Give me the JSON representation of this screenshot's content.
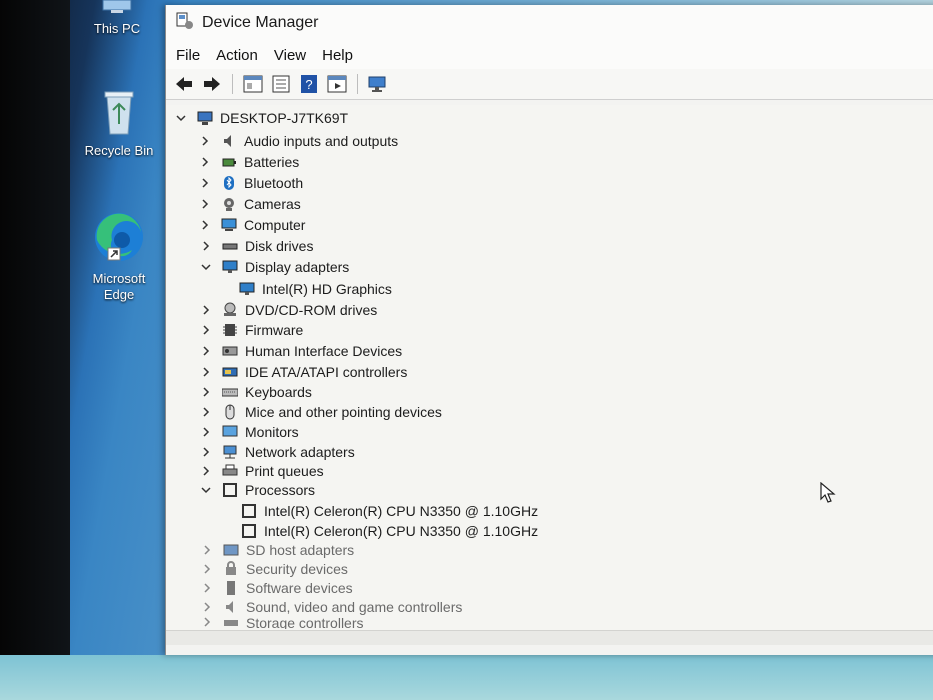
{
  "desktop": {
    "icons": [
      {
        "label": "This PC",
        "icon": "this-pc-icon"
      },
      {
        "label": "Recycle Bin",
        "icon": "recycle-bin-icon"
      },
      {
        "label_line1": "Microsoft",
        "label_line2": "Edge",
        "icon": "edge-icon"
      }
    ]
  },
  "window": {
    "title": "Device Manager",
    "menu": [
      "File",
      "Action",
      "View",
      "Help"
    ],
    "toolbar": [
      "back-icon",
      "forward-icon",
      "properties-icon",
      "show-hidden-icon",
      "help-icon",
      "run-icon",
      "scan-hardware-icon"
    ]
  },
  "tree": {
    "root": "DESKTOP-J7TK69T",
    "items": [
      {
        "label": "Audio inputs and outputs",
        "icon": "speaker-icon",
        "expanded": false
      },
      {
        "label": "Batteries",
        "icon": "battery-icon",
        "expanded": false
      },
      {
        "label": "Bluetooth",
        "icon": "bluetooth-icon",
        "expanded": false
      },
      {
        "label": "Cameras",
        "icon": "camera-icon",
        "expanded": false
      },
      {
        "label": "Computer",
        "icon": "computer-icon",
        "expanded": false
      },
      {
        "label": "Disk drives",
        "icon": "disk-drive-icon",
        "expanded": false
      },
      {
        "label": "Display adapters",
        "icon": "display-adapter-icon",
        "expanded": true,
        "children": [
          {
            "label": "Intel(R) HD Graphics",
            "icon": "display-adapter-icon"
          }
        ]
      },
      {
        "label": "DVD/CD-ROM drives",
        "icon": "dvd-icon",
        "expanded": false
      },
      {
        "label": "Firmware",
        "icon": "firmware-icon",
        "expanded": false
      },
      {
        "label": "Human Interface Devices",
        "icon": "hid-icon",
        "expanded": false
      },
      {
        "label": "IDE ATA/ATAPI controllers",
        "icon": "ide-icon",
        "expanded": false
      },
      {
        "label": "Keyboards",
        "icon": "keyboard-icon",
        "expanded": false
      },
      {
        "label": "Mice and other pointing devices",
        "icon": "mouse-icon",
        "expanded": false
      },
      {
        "label": "Monitors",
        "icon": "monitor-icon",
        "expanded": false
      },
      {
        "label": "Network adapters",
        "icon": "network-icon",
        "expanded": false
      },
      {
        "label": "Print queues",
        "icon": "printer-icon",
        "expanded": false
      },
      {
        "label": "Processors",
        "icon": "processor-icon",
        "expanded": true,
        "children": [
          {
            "label": "Intel(R) Celeron(R) CPU N3350 @ 1.10GHz",
            "icon": "processor-icon"
          },
          {
            "label": "Intel(R) Celeron(R) CPU N3350 @ 1.10GHz",
            "icon": "processor-icon"
          }
        ]
      },
      {
        "label": "SD host adapters",
        "icon": "sd-icon",
        "expanded": false
      },
      {
        "label": "Security devices",
        "icon": "security-icon",
        "expanded": false
      },
      {
        "label": "Software devices",
        "icon": "software-device-icon",
        "expanded": false
      },
      {
        "label": "Sound, video and game controllers",
        "icon": "sound-icon",
        "expanded": false
      },
      {
        "label": "Storage controllers",
        "icon": "storage-icon",
        "expanded": false
      }
    ]
  },
  "colors": {
    "accent": "#1e6fc2",
    "window_bg": "#f5f5f2",
    "text": "#1c1c1c"
  }
}
